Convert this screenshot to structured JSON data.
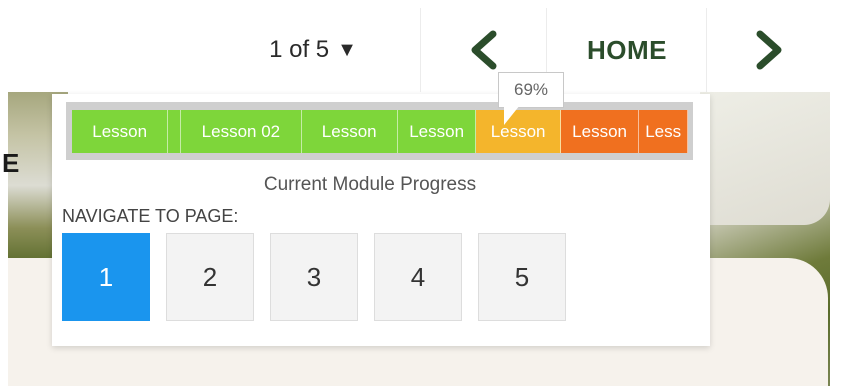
{
  "header": {
    "page_indicator": "1 of 5",
    "page_caret": "▼",
    "home_label": "HOME",
    "prev_icon": "chevron-left-icon",
    "next_icon": "chevron-right-icon",
    "chevron_color": "#2b4d2b"
  },
  "background": {
    "partial_letter": "E"
  },
  "progress": {
    "caption": "Current Module Progress",
    "percent_label": "69%",
    "percent_value": 69,
    "segments": [
      {
        "label": "Lesson",
        "color": "#7ed63a",
        "weight": 16
      },
      {
        "label": "",
        "color": "#7ed63a",
        "weight": 2
      },
      {
        "label": "Lesson 02",
        "color": "#7ed63a",
        "weight": 20
      },
      {
        "label": "Lesson",
        "color": "#7ed63a",
        "weight": 16
      },
      {
        "label": "Lesson",
        "color": "#7ed63a",
        "weight": 13
      },
      {
        "label": "Lesson",
        "color": "#f4b52c",
        "weight": 14
      },
      {
        "label": "Lesson",
        "color": "#f0701f",
        "weight": 13
      },
      {
        "label": "Less",
        "color": "#f0701f",
        "weight": 8
      }
    ]
  },
  "navigate": {
    "label": "NAVIGATE TO PAGE:",
    "pages": [
      "1",
      "2",
      "3",
      "4",
      "5"
    ],
    "active_page": "1",
    "active_color": "#1a95ee"
  }
}
